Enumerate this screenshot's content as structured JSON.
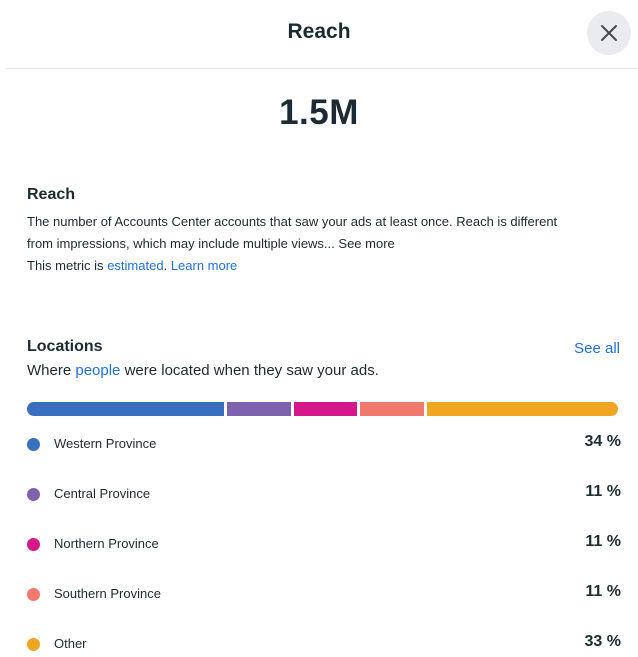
{
  "header": {
    "title": "Reach",
    "close_icon": "close-icon"
  },
  "metric": {
    "value": "1.5M"
  },
  "reach_info": {
    "heading": "Reach",
    "description_line1": "The number of Accounts Center accounts that saw your ads at least once. Reach is different",
    "description_line2": "from impressions, which may include multiple views...",
    "see_more": "See more",
    "estimate_prefix": "This metric is",
    "estimate_link": "estimated",
    "learn_more": "Learn more"
  },
  "locations": {
    "heading": "Locations",
    "see_all": "See all",
    "subtitle_prefix": "Where",
    "subtitle_link": "people",
    "subtitle_suffix": "were located when they saw your ads.",
    "items": [
      {
        "name": "Western Province",
        "percent": "34 %",
        "value": 34,
        "color": "#3a6fbf"
      },
      {
        "name": "Central Province",
        "percent": "11 %",
        "value": 11,
        "color": "#7e62ae"
      },
      {
        "name": "Northern Province",
        "percent": "11 %",
        "value": 11,
        "color": "#d4178a"
      },
      {
        "name": "Southern Province",
        "percent": "11 %",
        "value": 11,
        "color": "#f0786d"
      },
      {
        "name": "Other",
        "percent": "33 %",
        "value": 33,
        "color": "#f0a623"
      }
    ]
  }
}
